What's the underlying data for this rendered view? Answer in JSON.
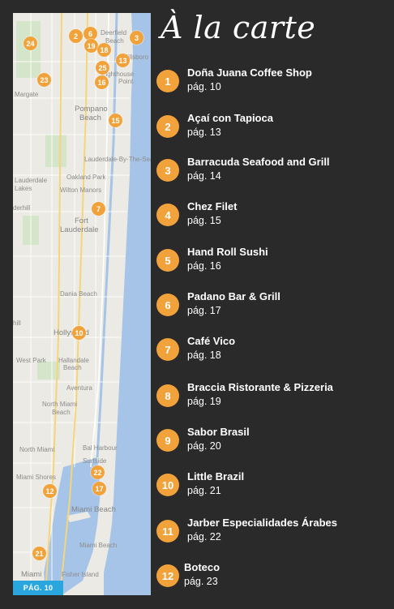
{
  "title": "À la carte",
  "page_badge": "PÁG. 10",
  "map": {
    "place_labels": [
      {
        "text": "Deerfield",
        "big": false
      },
      {
        "text": "Beach",
        "big": false
      },
      {
        "text": "Margate",
        "big": false
      },
      {
        "text": "Pompano",
        "big": true
      },
      {
        "text": "Beach",
        "big": true
      },
      {
        "text": "Lighthouse",
        "big": false
      },
      {
        "text": "Point",
        "big": false
      },
      {
        "text": "Hillsboro",
        "big": false
      },
      {
        "text": "Lauderdale-By-The-Sea",
        "big": false
      },
      {
        "text": "Oakland Park",
        "big": false
      },
      {
        "text": "Wilton Manors",
        "big": false
      },
      {
        "text": "Lauderdale",
        "big": false
      },
      {
        "text": "Lakes",
        "big": false
      },
      {
        "text": "Fort",
        "big": true
      },
      {
        "text": "Lauderdale",
        "big": true
      },
      {
        "text": "Dania Beach",
        "big": false
      },
      {
        "text": "Hollywood",
        "big": true
      },
      {
        "text": "West Park",
        "big": false
      },
      {
        "text": "Hallandale",
        "big": false
      },
      {
        "text": "Beach",
        "big": false
      },
      {
        "text": "Aventura",
        "big": false
      },
      {
        "text": "North Miami",
        "big": false
      },
      {
        "text": "Beach",
        "big": false
      },
      {
        "text": "North Miami",
        "big": false
      },
      {
        "text": "Bal Harbour",
        "big": false
      },
      {
        "text": "Surfside",
        "big": false
      },
      {
        "text": "Miami Shores",
        "big": false
      },
      {
        "text": "Miami Beach",
        "big": true
      },
      {
        "text": "Miami Beach",
        "big": false
      },
      {
        "text": "Miami",
        "big": true
      },
      {
        "text": "Fisher Island",
        "big": false
      },
      {
        "text": "derhill",
        "big": false
      },
      {
        "text": "hill",
        "big": false
      }
    ],
    "pins": [
      "24",
      "2",
      "6",
      "3",
      "19",
      "18",
      "13",
      "25",
      "23",
      "16",
      "15",
      "7",
      "10",
      "22",
      "12",
      "17",
      "21"
    ]
  },
  "entries": [
    {
      "num": "1",
      "name": "Doña Juana Coffee Shop",
      "page": "pág. 10"
    },
    {
      "num": "2",
      "name": "Açaí con Tapioca",
      "page": "pág. 13"
    },
    {
      "num": "3",
      "name": "Barracuda Seafood and Grill",
      "page": "pág. 14"
    },
    {
      "num": "4",
      "name": "Chez Filet",
      "page": "pág. 15"
    },
    {
      "num": "5",
      "name": "Hand Roll Sushi",
      "page": "pág. 16"
    },
    {
      "num": "6",
      "name": "Padano Bar & Grill",
      "page": "pág. 17"
    },
    {
      "num": "7",
      "name": "Café Vico",
      "page": "pág. 18"
    },
    {
      "num": "8",
      "name": "Braccia Ristorante & Pizzeria",
      "page": "pág. 19"
    },
    {
      "num": "9",
      "name": "Sabor Brasil",
      "page": "pág. 20"
    },
    {
      "num": "10",
      "name": "Little Brazil",
      "page": "pág. 21"
    },
    {
      "num": "11",
      "name": "Jarber Especialidades Árabes",
      "page": "pág. 22"
    },
    {
      "num": "12",
      "name": "Boteco",
      "page": "pág. 23"
    }
  ]
}
